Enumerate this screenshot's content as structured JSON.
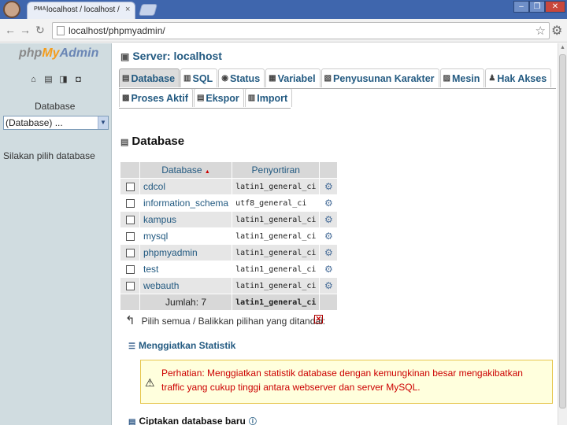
{
  "browser": {
    "tab_title": "localhost / localhost / phpMy",
    "tab_favicon": "PMA",
    "url": "localhost/phpmyadmin/"
  },
  "left": {
    "logo_php": "php",
    "logo_my": "My",
    "logo_admin": "Admin",
    "database_label": "Database",
    "database_select": "(Database) ...",
    "hint": "Silakan pilih database"
  },
  "main": {
    "server_title": "Server: localhost",
    "tabs_row1": [
      "Database",
      "SQL",
      "Status",
      "Variabel",
      "Penyusunan Karakter",
      "Mesin",
      "Hak Akses"
    ],
    "tabs_row2": [
      "Proses Aktif",
      "Ekspor",
      "Import"
    ],
    "section_title": "Database",
    "table": {
      "col_database": "Database",
      "col_sort": "Penyortiran",
      "rows": [
        {
          "name": "cdcol",
          "collation": "latin1_general_ci"
        },
        {
          "name": "information_schema",
          "collation": "utf8_general_ci"
        },
        {
          "name": "kampus",
          "collation": "latin1_general_ci"
        },
        {
          "name": "mysql",
          "collation": "latin1_general_ci"
        },
        {
          "name": "phpmyadmin",
          "collation": "latin1_general_ci"
        },
        {
          "name": "test",
          "collation": "latin1_general_ci"
        },
        {
          "name": "webauth",
          "collation": "latin1_general_ci"
        }
      ],
      "total_label": "Jumlah: 7",
      "total_collation": "latin1_general_ci"
    },
    "check_all": "Pilih semua / Balikkan pilihan yang ditandai:",
    "stats_link": "Menggiatkan Statistik",
    "notice": "Perhatian: Menggiatkan statistik database dengan kemungkinan besar mengakibatkan traffic yang cukup tinggi antara webserver dan server MySQL.",
    "create_db": "Ciptakan database baru"
  },
  "colors": {
    "link": "#235a81",
    "left_frame": "#d0dce0",
    "tabstrip": "#3f66ad",
    "notice_bg": "#ffffdd"
  }
}
